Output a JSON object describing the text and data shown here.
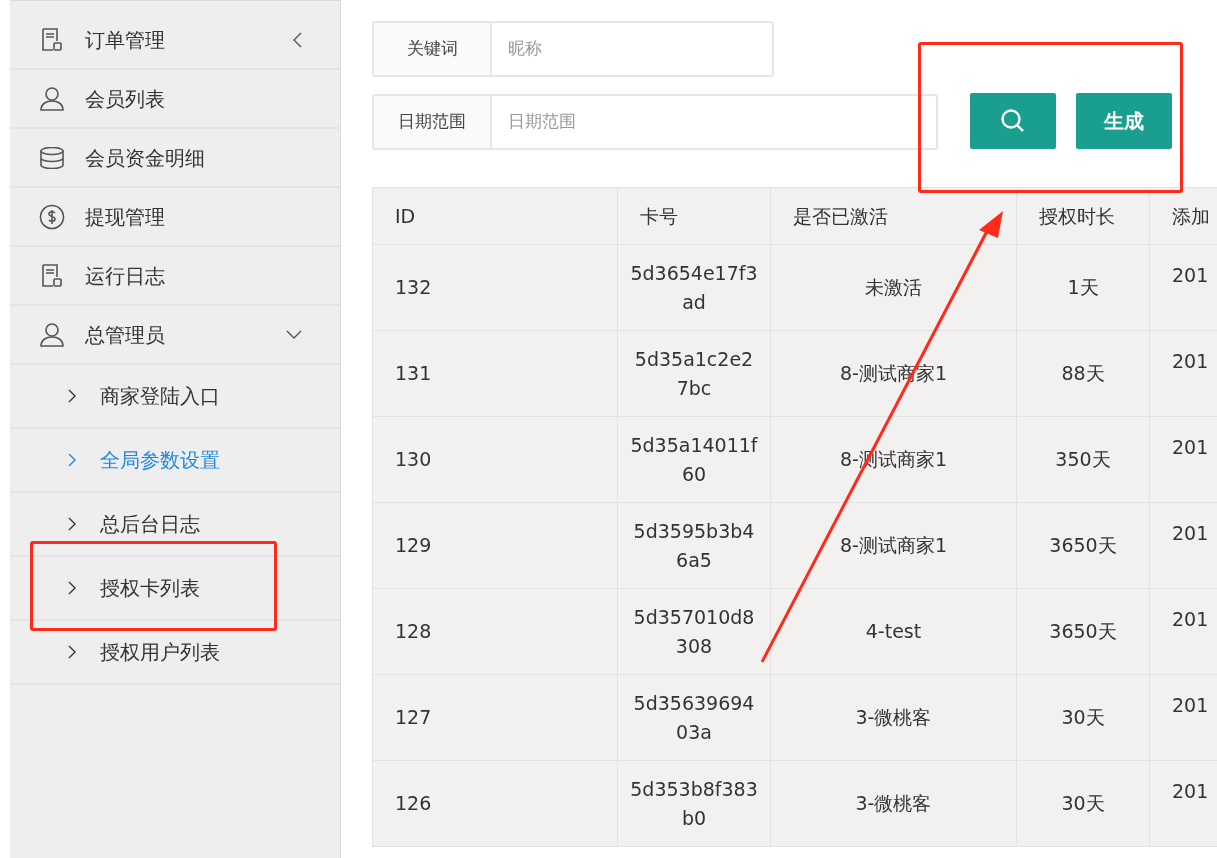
{
  "sidebar": {
    "items": [
      {
        "label": "订单管理",
        "expanded": false
      },
      {
        "label": "会员列表"
      },
      {
        "label": "会员资金明细"
      },
      {
        "label": "提现管理"
      },
      {
        "label": "运行日志"
      },
      {
        "label": "总管理员",
        "expanded": true,
        "children": [
          {
            "label": "商家登陆入口",
            "selected": false
          },
          {
            "label": "全局参数设置",
            "selected": true
          },
          {
            "label": "总后台日志",
            "selected": false
          },
          {
            "label": "授权卡列表",
            "selected": false
          },
          {
            "label": "授权用户列表",
            "selected": false
          }
        ]
      }
    ]
  },
  "filters": [
    {
      "label": "关键词",
      "placeholder": "昵称"
    },
    {
      "label": "日期范围",
      "placeholder": "日期范围"
    }
  ],
  "buttons": [
    {
      "kind": "search"
    },
    {
      "kind": "text",
      "label": "生成"
    }
  ],
  "table": {
    "columns": [
      "ID",
      "卡号",
      "是否已激活",
      "授权时长",
      "添加"
    ],
    "rows": [
      [
        "132",
        "5d3654e17f3ad",
        "未激活",
        "1天",
        "201"
      ],
      [
        "131",
        "5d35a1c2e27bc",
        "8-测试商家1",
        "88天",
        "201"
      ],
      [
        "130",
        "5d35a14011f60",
        "8-测试商家1",
        "350天",
        "201"
      ],
      [
        "129",
        "5d3595b3b46a5",
        "8-测试商家1",
        "3650天",
        "201"
      ],
      [
        "128",
        "5d357010d8308",
        "4-test",
        "3650天",
        "201"
      ],
      [
        "127",
        "5d3563969403a",
        "3-微桃客",
        "30天",
        "201"
      ],
      [
        "126",
        "5d353b8f383b0",
        "3-微桃客",
        "30天",
        "201"
      ]
    ]
  },
  "annotations": [
    {
      "kind": "box"
    },
    {
      "kind": "box"
    },
    {
      "kind": "arrow"
    }
  ]
}
